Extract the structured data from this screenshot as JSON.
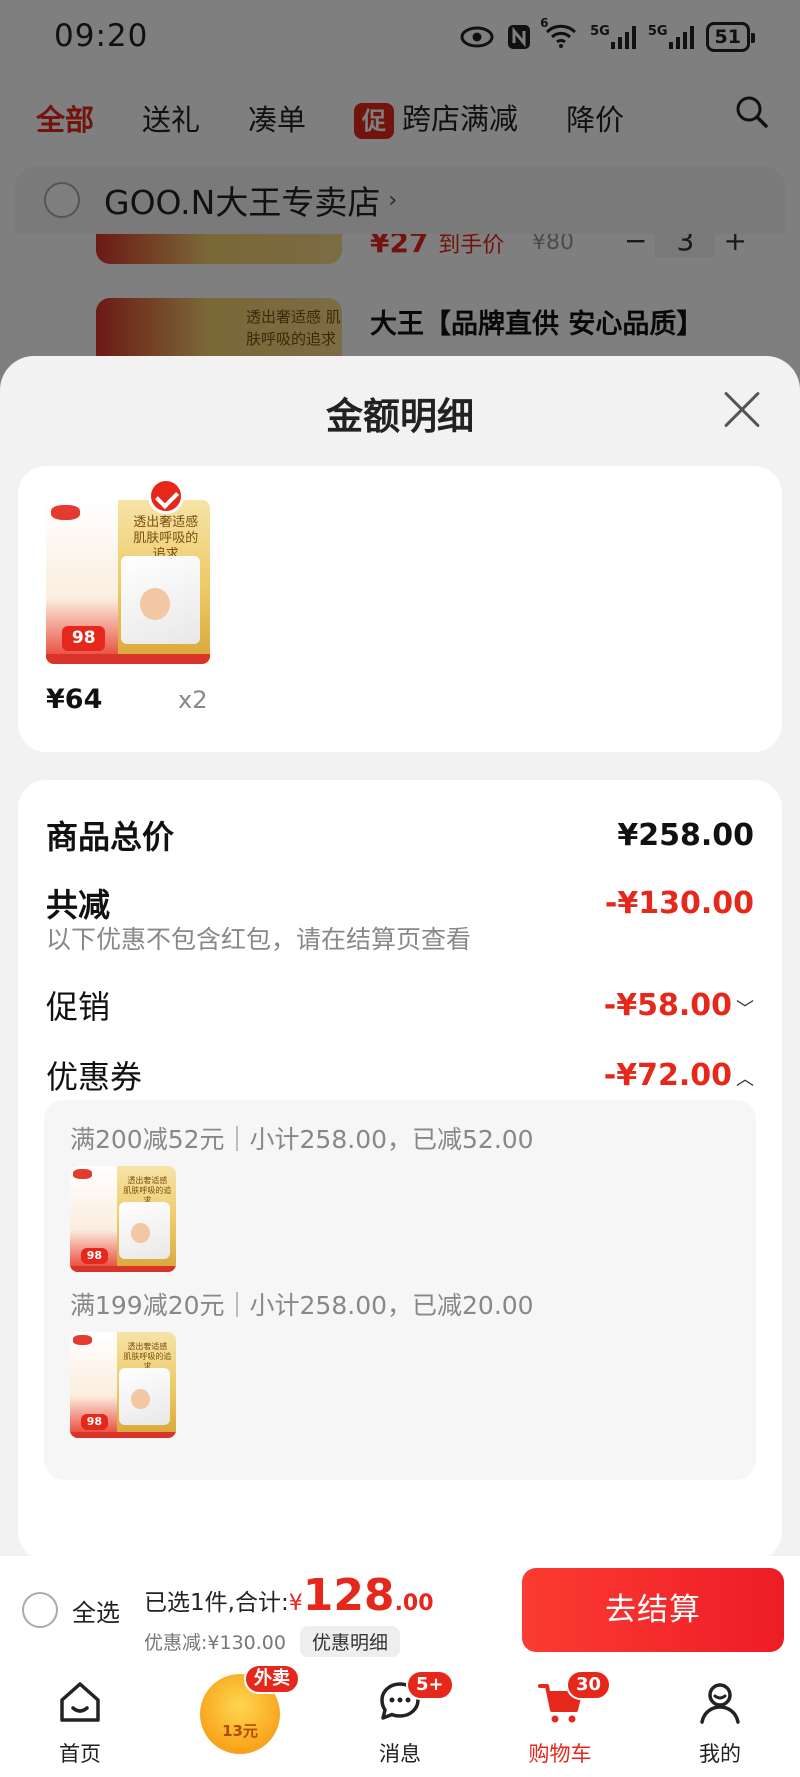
{
  "status_bar": {
    "time": "09:20",
    "signal1": "5G",
    "signal2": "5G",
    "wifi_label": "6",
    "battery": "51"
  },
  "cart_tabs": [
    {
      "label": "全部"
    },
    {
      "label": "送礼"
    },
    {
      "label": "凑单"
    },
    {
      "label": "跨店满减",
      "tag": "促"
    },
    {
      "label": "降价"
    }
  ],
  "store": {
    "name": "GOO.N大王专卖店",
    "arrow": "›"
  },
  "background_item1": {
    "price_prefix": "¥",
    "price": "27",
    "price_suffix": "到手价",
    "orig_price": "¥80",
    "qty_minus": "−",
    "qty": "3",
    "qty_plus": "+"
  },
  "background_item2": {
    "title": "大王【品牌直供 安心品质】",
    "slogan": "透出奢适感 肌肤呼吸的追求"
  },
  "sheet": {
    "title": "金额明细",
    "item": {
      "price": "¥64",
      "qty": "x2",
      "thumb_text": "透出奢适感 肌肤呼吸的追求",
      "thumb_price": "98"
    },
    "summary": {
      "total_label": "商品总价",
      "total_value": "¥258.00",
      "reduced_label": "共减",
      "reduced_value": "-¥130.00",
      "hint": "以下优惠不包含红包，请在结算页查看",
      "promo_label": "促销",
      "promo_value": "-¥58.00",
      "coupon_label": "优惠券",
      "coupon_value": "-¥72.00"
    },
    "coupons": [
      {
        "text": "满200减52元｜小计258.00，已减52.00",
        "thumb_text": "透出奢适感 肌肤呼吸的追求",
        "thumb_price": "98"
      },
      {
        "text": "满199减20元｜小计258.00，已减20.00",
        "thumb_text": "透出奢适感 肌肤呼吸的追求",
        "thumb_price": "98"
      }
    ]
  },
  "checkout": {
    "select_all": "全选",
    "selected_text": "已选1件,合计:",
    "currency": "¥",
    "total_int": "128",
    "total_dec": ".00",
    "discount_text": "优惠减:¥130.00",
    "detail_chip": "优惠明细",
    "button": "去结算"
  },
  "nav": {
    "items": [
      {
        "label": "首页",
        "icon": "home-icon"
      },
      {
        "label": "",
        "icon": "waimai-icon",
        "badge": "外卖",
        "amount": "13元"
      },
      {
        "label": "消息",
        "icon": "message-icon",
        "badge": "5+"
      },
      {
        "label": "购物车",
        "icon": "cart-icon",
        "badge": "30"
      },
      {
        "label": "我的",
        "icon": "profile-icon"
      }
    ]
  },
  "colors": {
    "accent": "#e5281b",
    "overlay": "rgba(0,0,0,0.5)",
    "sheet_bg": "#f2f2f2"
  }
}
